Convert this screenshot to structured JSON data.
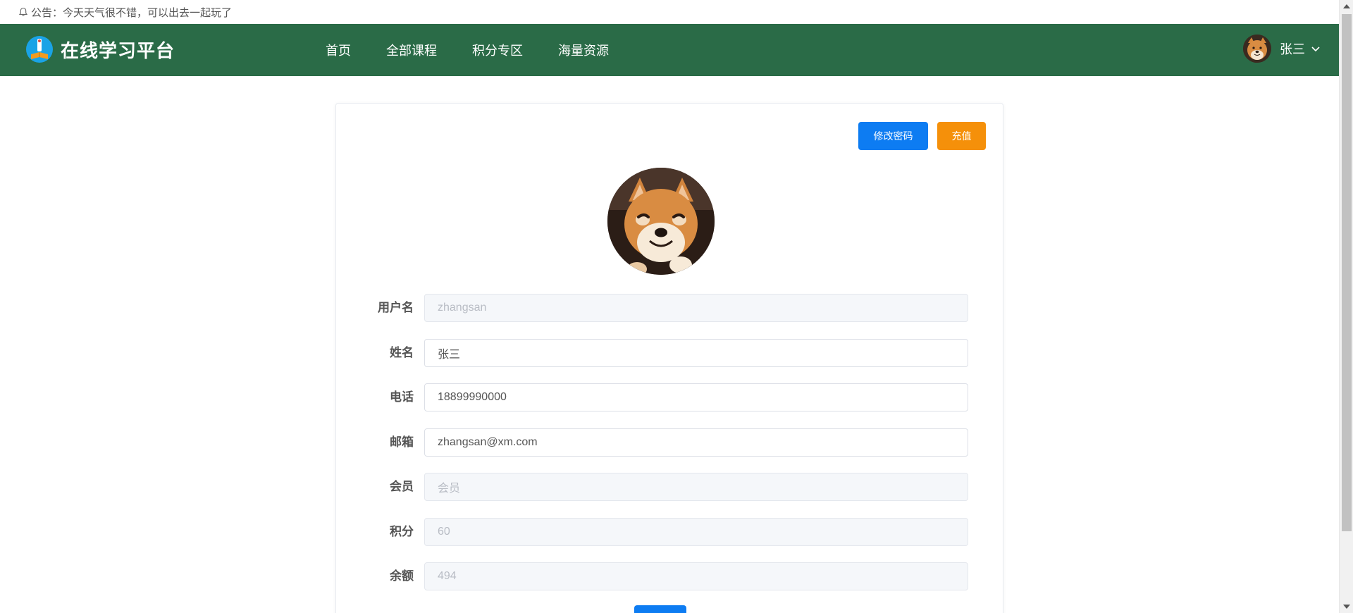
{
  "notice": {
    "text": "公告：今天天气很不错，可以出去一起玩了"
  },
  "header": {
    "title": "在线学习平台",
    "nav": [
      "首页",
      "全部课程",
      "积分专区",
      "海量资源"
    ],
    "user_name": "张三"
  },
  "toolbar": {
    "change_password_label": "修改密码",
    "recharge_label": "充值"
  },
  "form": {
    "username": {
      "label": "用户名",
      "value": "zhangsan"
    },
    "name": {
      "label": "姓名",
      "value": "张三"
    },
    "phone": {
      "label": "电话",
      "value": "18899990000"
    },
    "email": {
      "label": "邮箱",
      "value": "zhangsan@xm.com"
    },
    "member": {
      "label": "会员",
      "value": "会员"
    },
    "points": {
      "label": "积分",
      "value": "60"
    },
    "balance": {
      "label": "余额",
      "value": "494"
    }
  },
  "colors": {
    "header_bg": "#2a6b47",
    "primary": "#0d7cf2",
    "warning": "#f5900a"
  }
}
